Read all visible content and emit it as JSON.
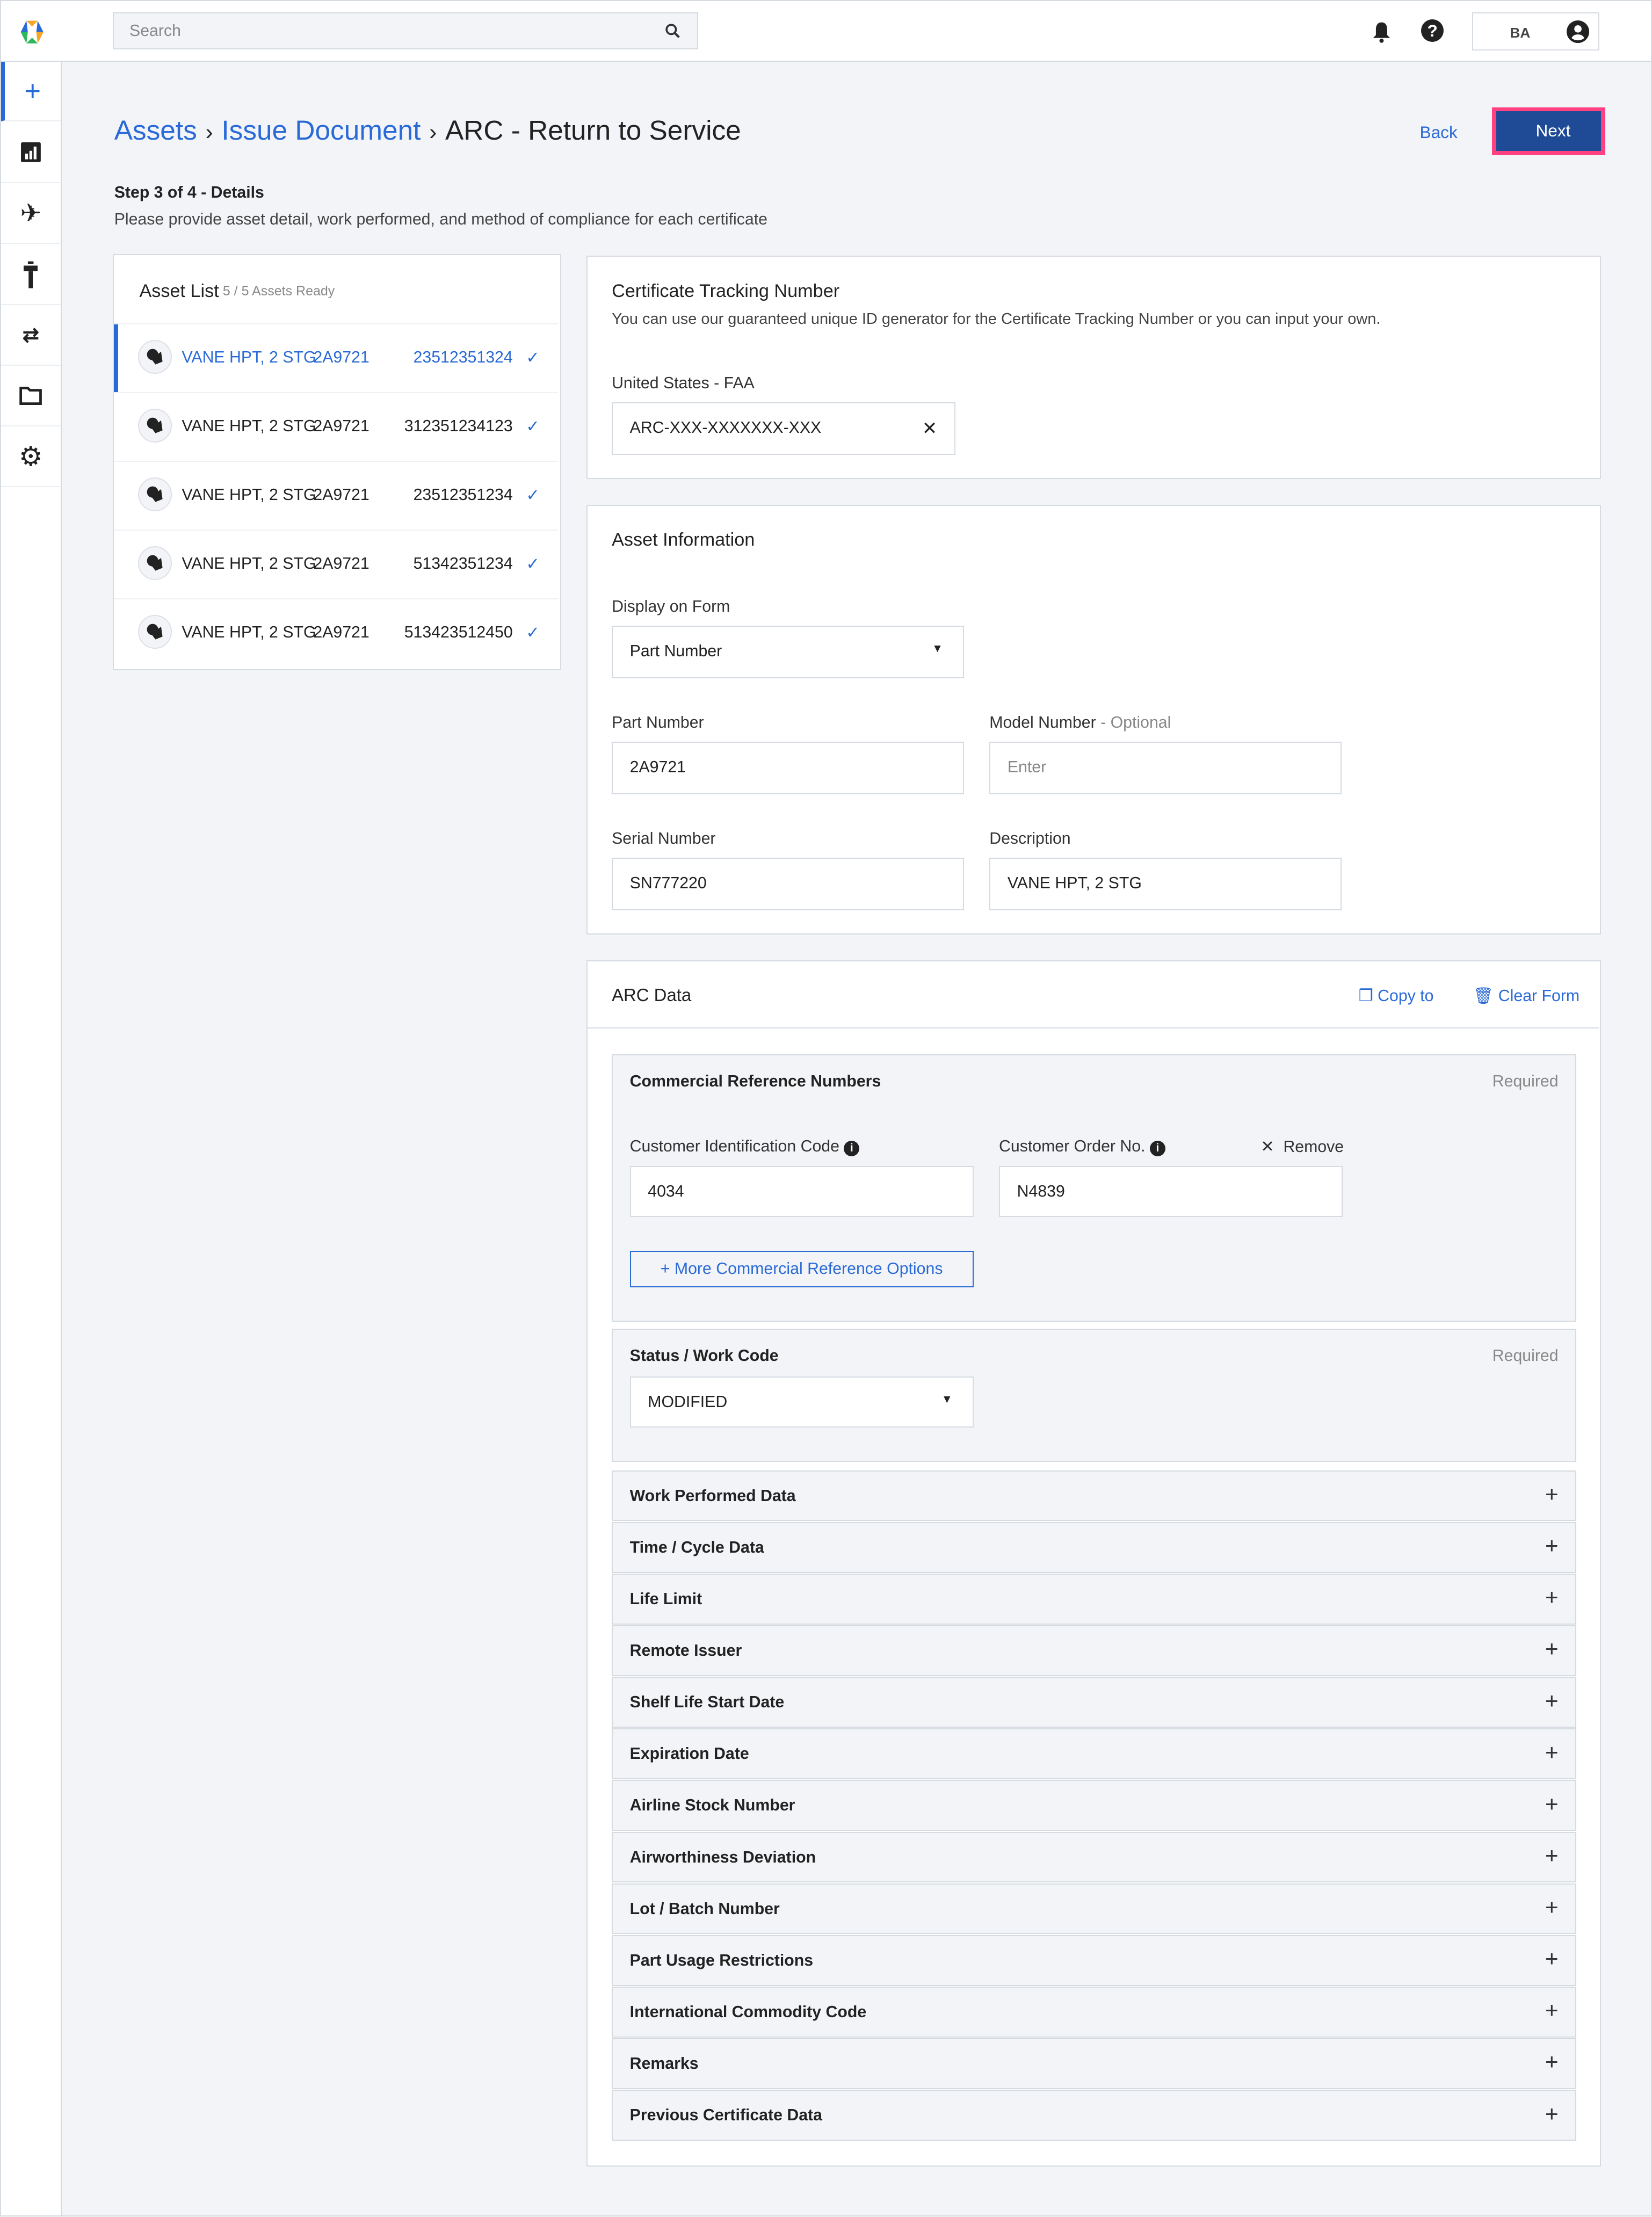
{
  "header": {
    "search_placeholder": "Search",
    "user_initials": "BA"
  },
  "sidebar": {
    "items": [
      {
        "icon": "plus-icon",
        "active": true
      },
      {
        "icon": "report-icon"
      },
      {
        "icon": "airplane-icon"
      },
      {
        "icon": "control-tower-icon"
      },
      {
        "icon": "transfer-icon"
      },
      {
        "icon": "folder-icon"
      },
      {
        "icon": "settings-icon"
      }
    ]
  },
  "breadcrumb": {
    "items": [
      "Assets",
      "Issue Document"
    ],
    "current": "ARC - Return to Service"
  },
  "actions": {
    "back": "Back",
    "next": "Next"
  },
  "step": {
    "title": "Step 3 of 4 - Details",
    "subtitle": "Please provide asset detail, work performed, and method of compliance for each certificate"
  },
  "asset_list": {
    "title": "Asset List",
    "status": "5 / 5 Assets Ready",
    "rows": [
      {
        "name": "VANE HPT, 2 STG",
        "part": "2A9721",
        "serial": "23512351324",
        "selected": true
      },
      {
        "name": "VANE HPT, 2 STG",
        "part": "2A9721",
        "serial": "312351234123"
      },
      {
        "name": "VANE HPT, 2 STG",
        "part": "2A9721",
        "serial": "23512351234"
      },
      {
        "name": "VANE HPT, 2 STG",
        "part": "2A9721",
        "serial": "51342351234"
      },
      {
        "name": "VANE HPT, 2 STG",
        "part": "2A9721",
        "serial": "513423512450"
      }
    ]
  },
  "certificate": {
    "title": "Certificate Tracking Number",
    "description": "You can use our guaranteed unique ID generator for the Certificate Tracking Number or you can input your own.",
    "field_label": "United States - FAA",
    "value": "ARC-XXX-XXXXXXX-XXX"
  },
  "asset_info": {
    "title": "Asset Information",
    "display_label": "Display on Form",
    "display_value": "Part Number",
    "part_label": "Part Number",
    "part_value": "2A9721",
    "model_label": "Model Number",
    "model_optional": " - Optional",
    "model_placeholder": "Enter",
    "serial_label": "Serial Number",
    "serial_value": "SN777220",
    "desc_label": "Description",
    "desc_value": "VANE HPT, 2 STG"
  },
  "arc": {
    "title": "ARC Data",
    "copy": "Copy to",
    "clear": "Clear Form",
    "commercial": {
      "title": "Commercial Reference Numbers",
      "required": "Required",
      "cic_label": "Customer Identification Code",
      "cic_value": "4034",
      "order_label": "Customer Order No.",
      "order_value": "N4839",
      "remove": "Remove",
      "more": "More Commercial Reference Options"
    },
    "status": {
      "title": "Status / Work Code",
      "required": "Required",
      "value": "MODIFIED"
    },
    "sections": [
      "Work Performed Data",
      "Time / Cycle Data",
      "Life Limit",
      "Remote Issuer",
      "Shelf Life Start Date",
      "Expiration Date",
      "Airline Stock Number",
      "Airworthiness Deviation",
      "Lot / Batch Number",
      "Part Usage Restrictions",
      "International Commodity Code",
      "Remarks",
      "Previous Certificate Data"
    ]
  },
  "colors": {
    "accent": "#2a6ad6",
    "primary_button": "#1f4b96",
    "highlight": "#ff4081"
  }
}
